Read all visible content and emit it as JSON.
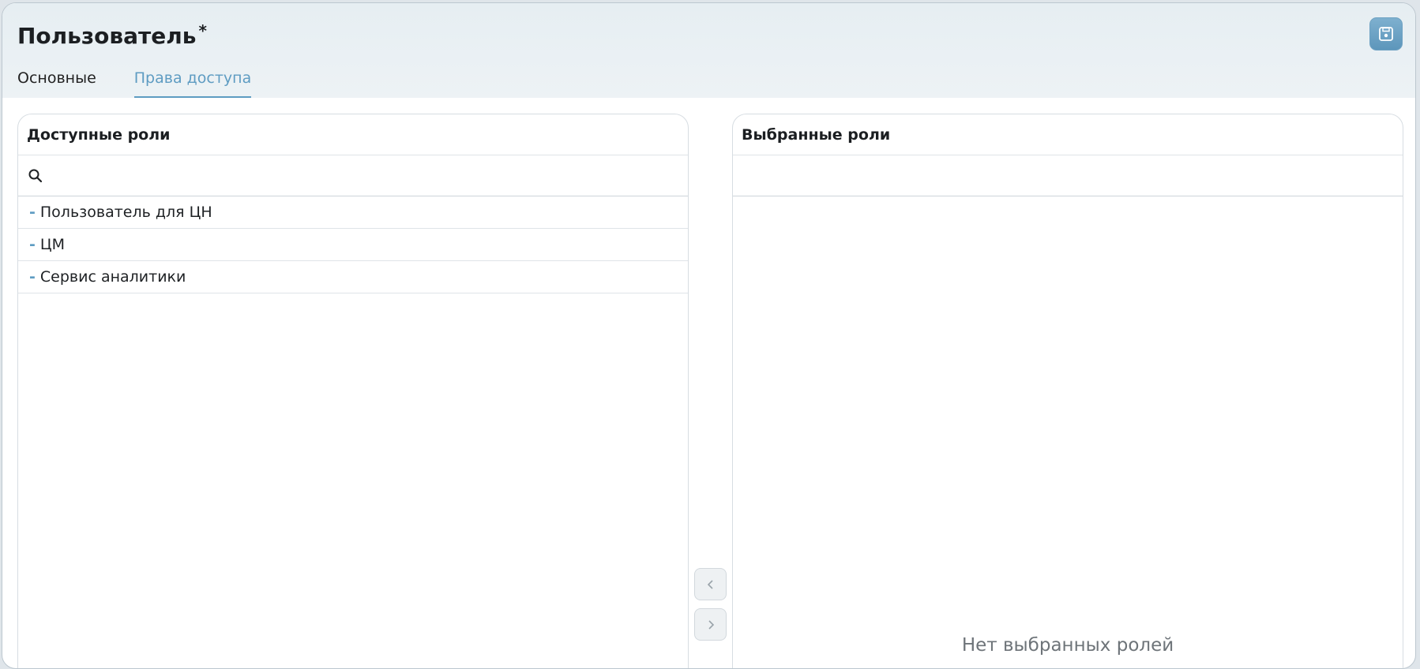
{
  "header": {
    "title": "Пользователь",
    "modified_marker": "*",
    "save_icon": "floppy-disk-icon"
  },
  "tabs": [
    {
      "label": "Основные",
      "active": false
    },
    {
      "label": "Права доступа",
      "active": true
    }
  ],
  "available_roles": {
    "title": "Доступные роли",
    "search_icon": "search-icon",
    "search_value": "",
    "items": [
      {
        "label": "Пользователь для ЦН"
      },
      {
        "label": "ЦМ"
      },
      {
        "label": "Сервис аналитики"
      }
    ]
  },
  "selected_roles": {
    "title": "Выбранные роли",
    "empty_text": "Нет выбранных ролей"
  },
  "transfer": {
    "move_left_icon": "chevron-left-icon",
    "move_right_icon": "chevron-right-icon"
  },
  "colors": {
    "accent": "#5e9cc2",
    "header_bg": "#e6eef2",
    "save_button": "#6ea2c3"
  }
}
